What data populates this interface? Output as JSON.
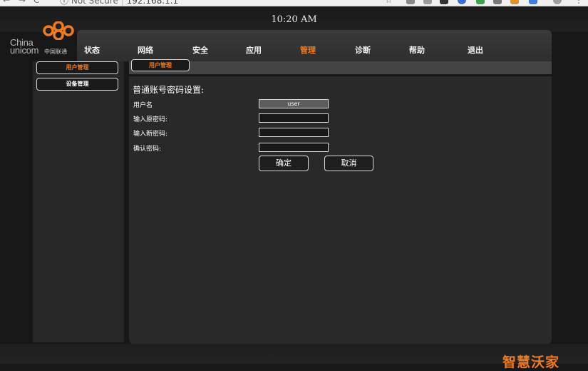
{
  "browser": {
    "security_label": "Not Secure",
    "url": "192.168.1.1",
    "nav_back": "←",
    "nav_forward": "→",
    "nav_reload": "C",
    "info_glyph": "ⓘ",
    "star_glyph": "☆"
  },
  "header": {
    "time": "10:20 AM",
    "logo_brand_en": "China unicom",
    "logo_brand_cn": "中国联通"
  },
  "menu": {
    "items": [
      {
        "label": "状态"
      },
      {
        "label": "网络"
      },
      {
        "label": "安全"
      },
      {
        "label": "应用"
      },
      {
        "label": "管理",
        "active": true
      },
      {
        "label": "诊断"
      },
      {
        "label": "帮助"
      },
      {
        "label": "退出"
      }
    ]
  },
  "sidebar": {
    "items": [
      {
        "label": "用户管理",
        "active": true
      },
      {
        "label": "设备管理"
      }
    ]
  },
  "subtab": {
    "label": "用户管理"
  },
  "form": {
    "title": "普通账号密码设置:",
    "username_label": "用户名",
    "username_value": "user",
    "old_password_label": "输入原密码:",
    "new_password_label": "输入新密码:",
    "confirm_password_label": "确认密码:",
    "confirm_button": "确定",
    "cancel_button": "取消"
  },
  "watermark": {
    "text": "智慧沃家"
  },
  "colors": {
    "accent": "#f07a1e",
    "background": "#171717",
    "panel": "#292929"
  }
}
